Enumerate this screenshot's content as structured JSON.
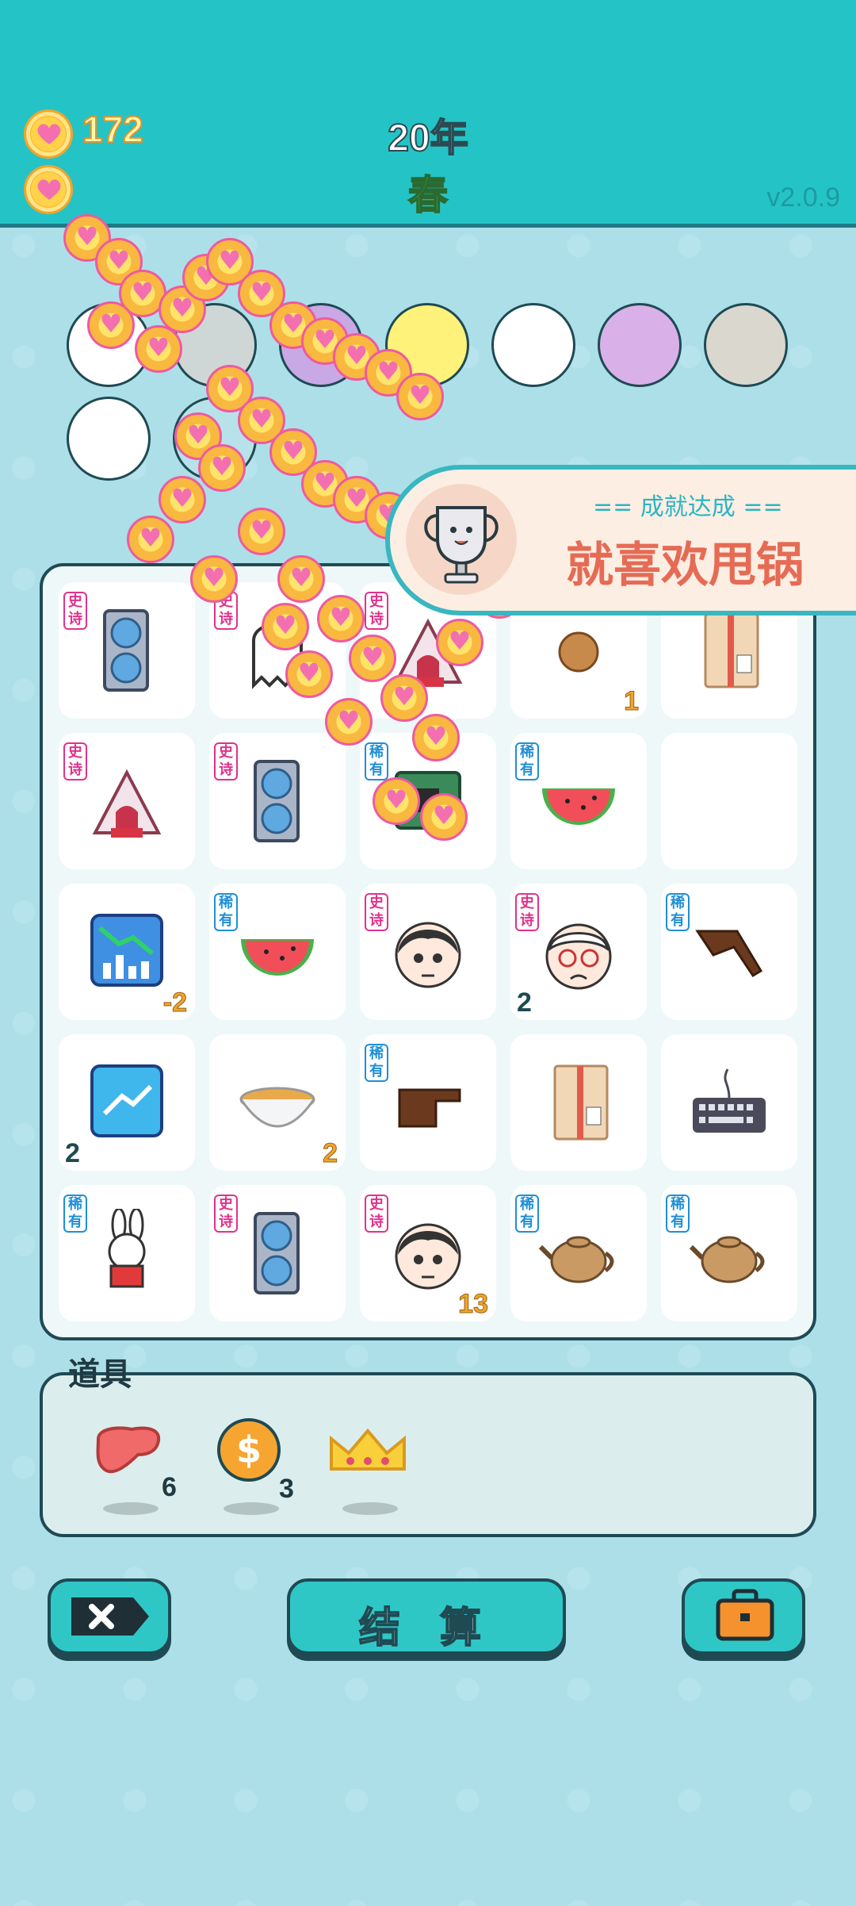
{
  "header": {
    "coins": "172",
    "year": "20年",
    "season": "春",
    "version": "v2.0.9"
  },
  "achievement": {
    "subtitle": "== 成就达成 ==",
    "title": "就喜欢甩锅"
  },
  "slots": [
    {
      "name": "pump-icon",
      "bg": "#ffffff"
    },
    {
      "name": "hidden-slot-icon",
      "bg": "#cfd6d6"
    },
    {
      "name": "gift-box-icon",
      "bg": "#c9a8e6"
    },
    {
      "name": "hidden-slot-icon",
      "bg": "#cfd6d6"
    },
    {
      "name": "basketballs-icon",
      "bg": "#fff27a"
    },
    {
      "name": "duck-pot-icon",
      "bg": "#ffffff"
    },
    {
      "name": "rabbit-icon",
      "bg": "#d9b1e8"
    },
    {
      "name": "screwdriver-icon",
      "bg": "#dad7cf"
    },
    {
      "name": "rice-bowl-icon",
      "bg": "#ffffff"
    },
    {
      "name": "hidden-slot-icon",
      "bg": "#b7e2ea"
    }
  ],
  "grid": [
    [
      {
        "icon": "graphics-card-icon",
        "tag": "史诗",
        "tagType": "epic",
        "count": ""
      },
      {
        "icon": "ghost-icon",
        "tag": "史诗",
        "tagType": "epic",
        "count": ""
      },
      {
        "icon": "red-house-icon",
        "tag": "史诗",
        "tagType": "epic",
        "count": ""
      },
      {
        "icon": "walnut-icon",
        "tag": "",
        "tagType": "",
        "count": "1"
      },
      {
        "icon": "parcel-box-icon",
        "tag": "",
        "tagType": "",
        "count": ""
      }
    ],
    [
      {
        "icon": "rabbit-tent-icon",
        "tag": "史诗",
        "tagType": "epic",
        "count": ""
      },
      {
        "icon": "graphics-card-icon",
        "tag": "史诗",
        "tagType": "epic",
        "count": ""
      },
      {
        "icon": "circuit-board-icon",
        "tag": "稀有",
        "tagType": "rare",
        "count": ""
      },
      {
        "icon": "watermelon-icon",
        "tag": "稀有",
        "tagType": "rare",
        "count": ""
      },
      {
        "icon": "empty-cell",
        "tag": "",
        "tagType": "",
        "count": ""
      }
    ],
    [
      {
        "icon": "falling-chart-icon",
        "tag": "",
        "tagType": "",
        "count": "-2"
      },
      {
        "icon": "watermelon-icon",
        "tag": "稀有",
        "tagType": "rare",
        "count": ""
      },
      {
        "icon": "confused-face-icon",
        "tag": "史诗",
        "tagType": "epic",
        "count": ""
      },
      {
        "icon": "old-man-face-icon",
        "tag": "史诗",
        "tagType": "epic",
        "count": "2",
        "countLeft": true
      },
      {
        "icon": "pointing-hand-down-icon",
        "tag": "稀有",
        "tagType": "rare",
        "count": ""
      }
    ],
    [
      {
        "icon": "rising-chart-icon",
        "tag": "",
        "tagType": "",
        "count": "2",
        "countLeft": true
      },
      {
        "icon": "soup-bowl-icon",
        "tag": "",
        "tagType": "",
        "count": "2"
      },
      {
        "icon": "pointing-hand-right-icon",
        "tag": "稀有",
        "tagType": "rare",
        "count": ""
      },
      {
        "icon": "parcel-box-icon",
        "tag": "",
        "tagType": "",
        "count": ""
      },
      {
        "icon": "keyboard-icon",
        "tag": "",
        "tagType": "",
        "count": ""
      }
    ],
    [
      {
        "icon": "rabbit-icon",
        "tag": "稀有",
        "tagType": "rare",
        "count": ""
      },
      {
        "icon": "graphics-card-icon",
        "tag": "史诗",
        "tagType": "epic",
        "count": ""
      },
      {
        "icon": "blushing-face-icon",
        "tag": "史诗",
        "tagType": "epic",
        "count": "13"
      },
      {
        "icon": "teapot-icon",
        "tag": "稀有",
        "tagType": "rare",
        "count": ""
      },
      {
        "icon": "teapot-icon",
        "tag": "稀有",
        "tagType": "rare",
        "count": ""
      }
    ]
  ],
  "items": {
    "label": "道具",
    "list": [
      {
        "name": "liver-icon",
        "count": "6"
      },
      {
        "name": "dollar-coin-icon",
        "count": "3"
      },
      {
        "name": "crown-icon",
        "count": ""
      }
    ]
  },
  "buttons": {
    "settle": "结 算"
  },
  "colors": {
    "header": "#24c4c6",
    "accent": "#f0a52a",
    "epic": "#e0328c",
    "rare": "#1f8fd6"
  }
}
